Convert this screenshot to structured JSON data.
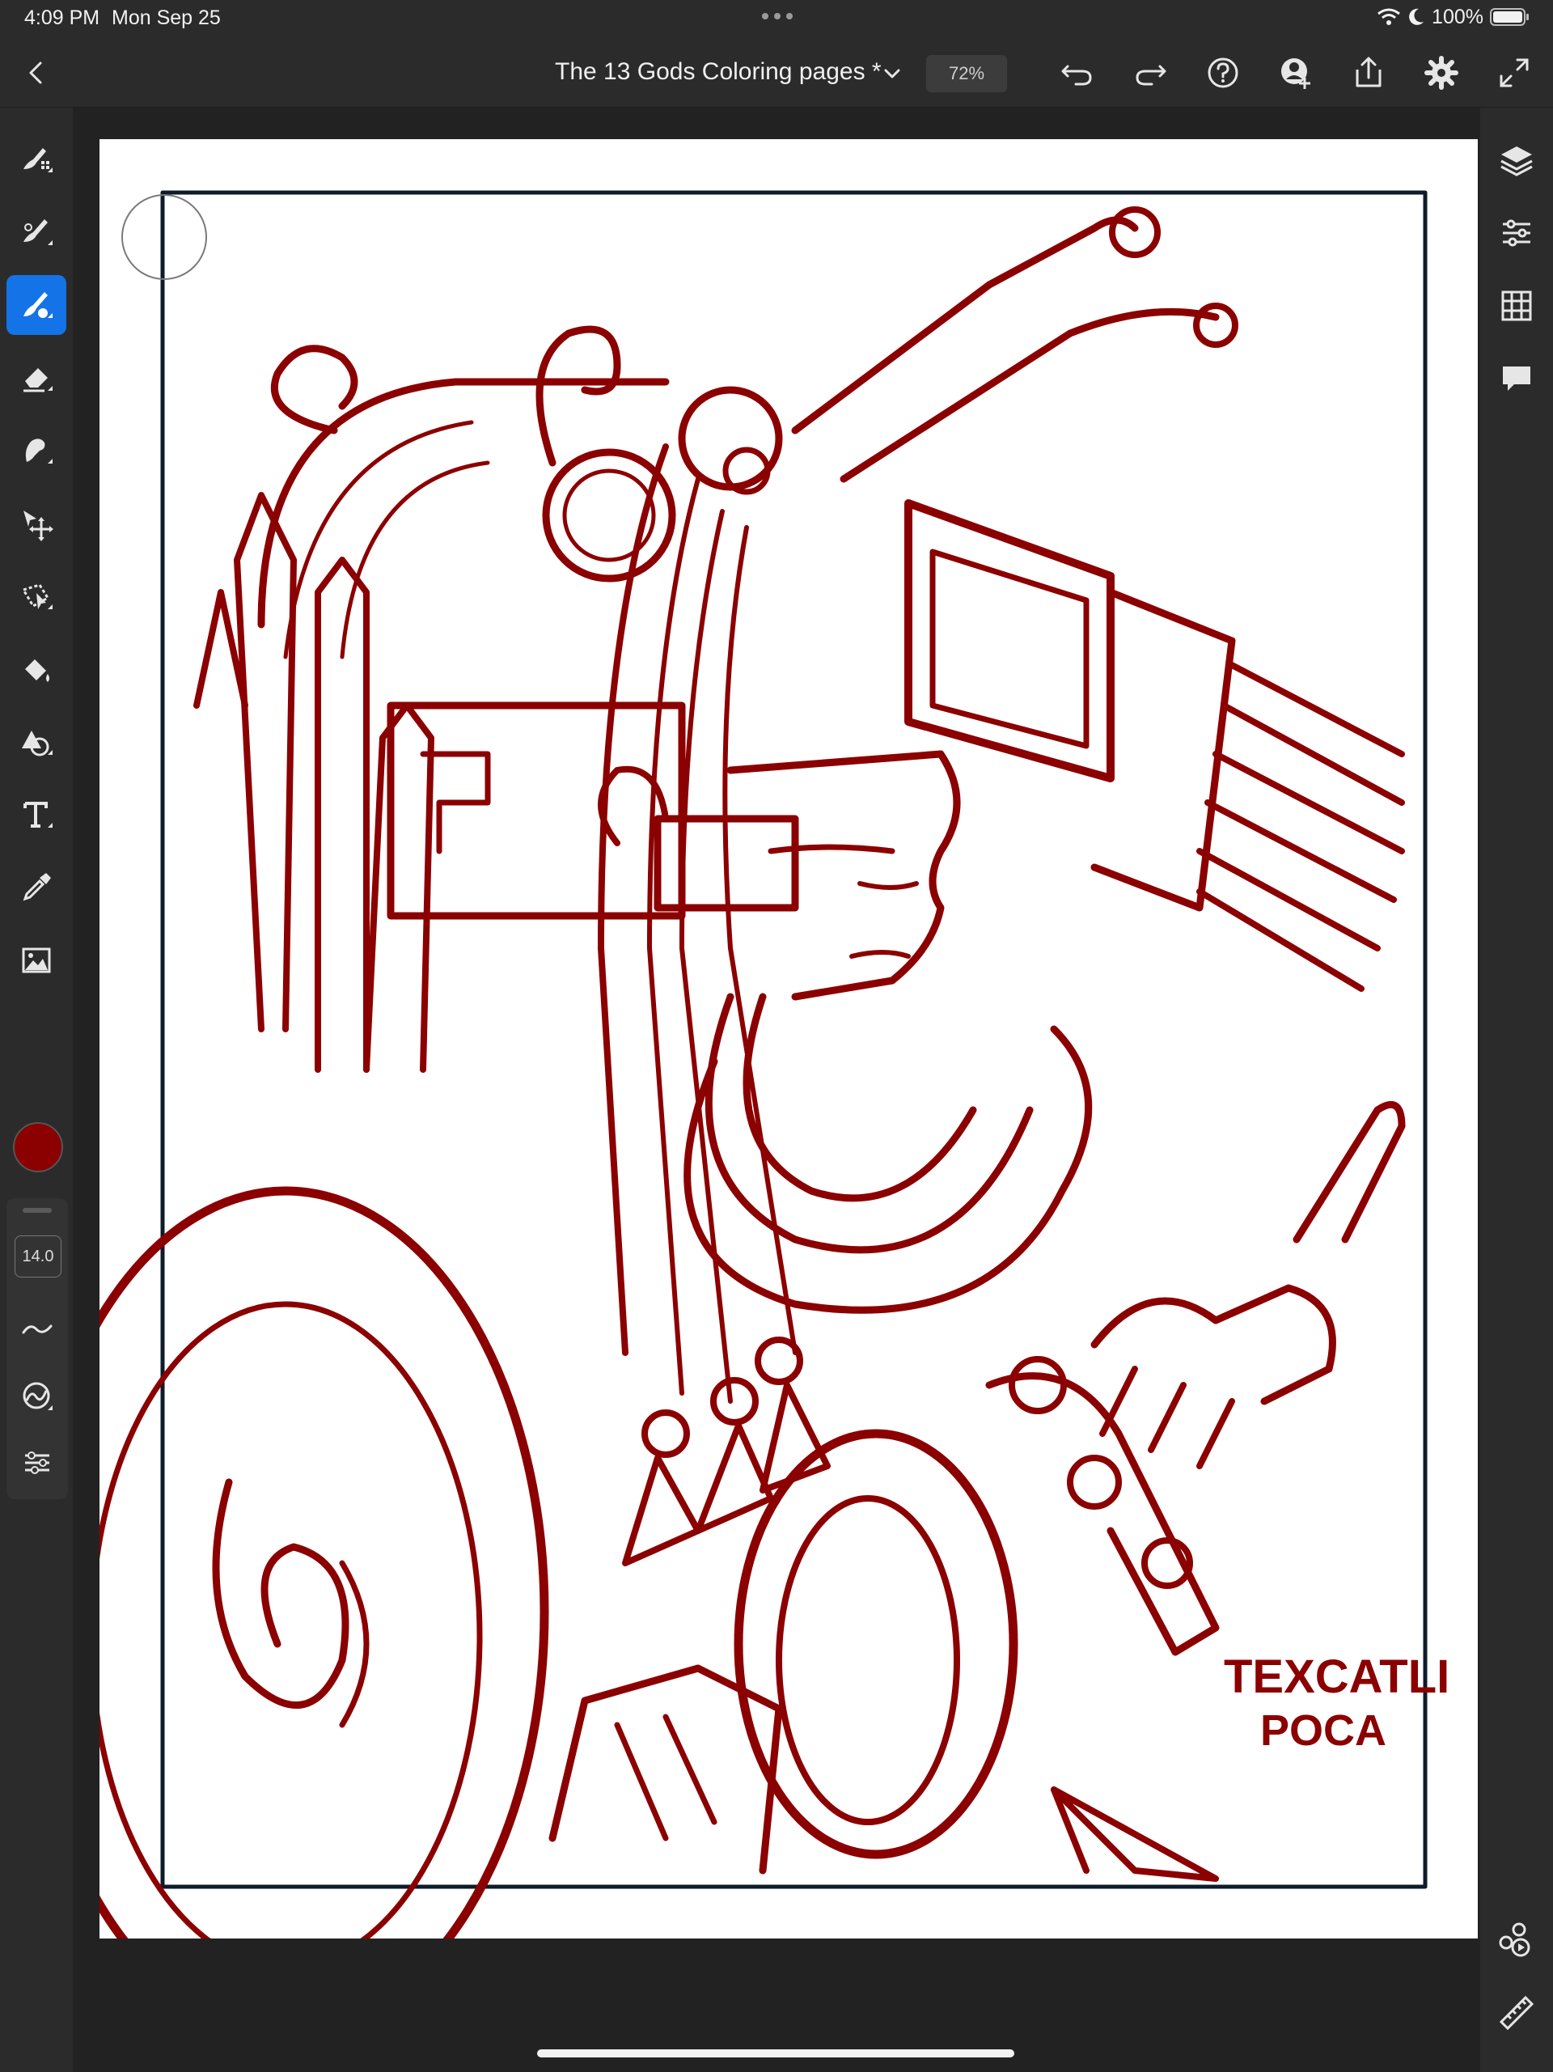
{
  "status_bar": {
    "time": "4:09 PM",
    "date": "Mon Sep 25",
    "battery_percent": "100%",
    "icons": [
      "wifi-icon",
      "moon-icon",
      "battery-icon"
    ]
  },
  "toolbar": {
    "document_title": "The 13 Gods Coloring pages *",
    "zoom": "72%",
    "icons": [
      "back-icon",
      "chevron-down-icon",
      "undo-icon",
      "redo-icon",
      "help-icon",
      "invite-user-icon",
      "share-icon",
      "settings-icon",
      "fullscreen-icon"
    ]
  },
  "left_toolbar": {
    "tools": [
      "pixel-brush-icon",
      "live-brush-icon",
      "vector-brush-icon",
      "eraser-icon",
      "smudge-icon",
      "move-icon",
      "selection-icon",
      "fill-icon",
      "shape-icon",
      "text-icon",
      "eyedropper-icon",
      "image-icon"
    ],
    "active_tool": "vector-brush-icon",
    "color": "#8b0000",
    "brush_size": "14.0",
    "panel_icons": [
      "smoothing-icon",
      "pressure-icon",
      "brush-settings-icon"
    ]
  },
  "right_toolbar": {
    "icons": [
      "layers-icon",
      "properties-icon",
      "grid-icon",
      "comments-icon",
      "touch-shortcut-icon",
      "ruler-icon"
    ]
  },
  "artwork": {
    "signature_line1": "TEXCATLI",
    "signature_line2": "POCA",
    "stroke_color": "#8b0000",
    "frame_color": "#0d1b2a"
  }
}
